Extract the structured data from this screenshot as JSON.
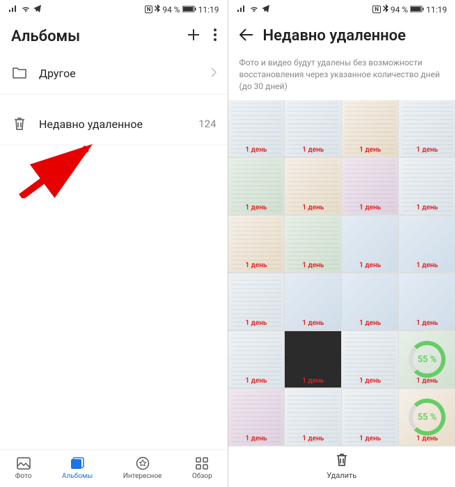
{
  "status": {
    "battery": "94 %",
    "time": "11:19"
  },
  "left": {
    "title": "Альбомы",
    "rows": [
      {
        "icon": "folder",
        "label": "Другое"
      },
      {
        "icon": "trash",
        "label": "Недавно удаленное",
        "count": "124"
      }
    ],
    "nav": [
      {
        "label": "Фото"
      },
      {
        "label": "Альбомы"
      },
      {
        "label": "Интересное"
      },
      {
        "label": "Обзор"
      }
    ]
  },
  "right": {
    "title": "Недавно удаленное",
    "info": "Фото и видео будут удалены без возможности восстановления через указанное количество дней (до 30 дней)",
    "thumb_label": "1 день",
    "green_pct": "55 %",
    "delete_label": "Удалить"
  }
}
